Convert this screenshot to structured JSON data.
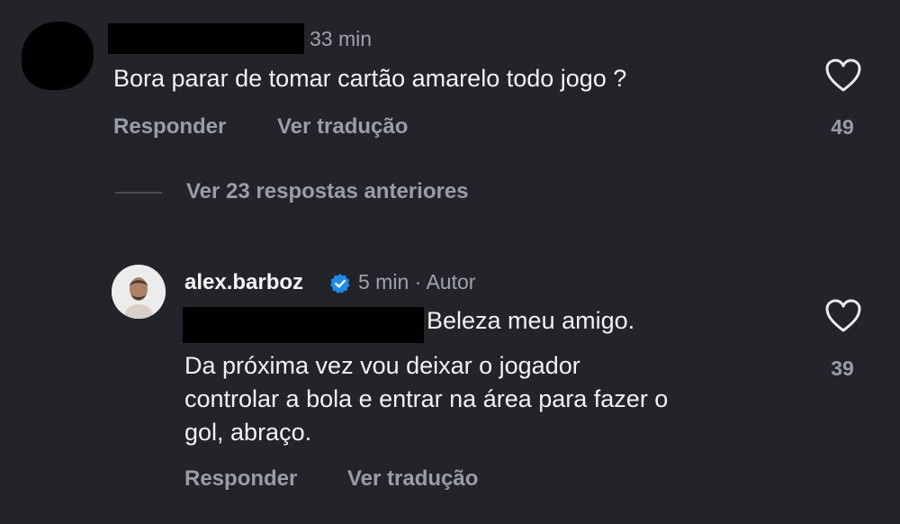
{
  "comment": {
    "time": "33 min",
    "text": "Bora parar de tomar cartão amarelo todo jogo ?",
    "reply_label": "Responder",
    "translate_label": "Ver tradução",
    "likes": "49"
  },
  "view_replies": {
    "label": "Ver 23 respostas anteriores"
  },
  "reply": {
    "username": "alex.barboz",
    "verified": true,
    "time": "5 min",
    "separator": "·",
    "author_label": "Autor",
    "lines": [
      "Beleza meu amigo.",
      "Da próxima vez vou deixar o jogador",
      "controlar a bola e entrar na área para fazer o",
      "gol, abraço."
    ],
    "likes": "39",
    "reply_label": "Responder",
    "translate_label": "Ver tradução"
  },
  "icons": {
    "like": "heart-outline-icon",
    "verified": "verified-badge-icon"
  },
  "colors": {
    "background": "#222429",
    "text_primary": "#f2f2f2",
    "text_secondary": "#9a9da3",
    "verified_blue": "#1d8cf0",
    "redaction": "#000000"
  }
}
